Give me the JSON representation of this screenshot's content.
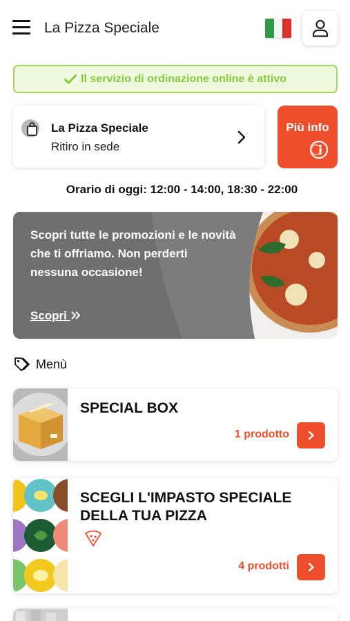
{
  "header": {
    "title": "La Pizza Speciale",
    "menu_icon": "hamburger-icon",
    "language_flag": "italy-flag-icon",
    "user_icon": "user-icon"
  },
  "status": {
    "text": "Il servizio di ordinazione online è attivo",
    "icon": "check-icon",
    "color": "#86c740"
  },
  "store": {
    "name": "La Pizza Speciale",
    "mode": "Ritiro in sede"
  },
  "info_button": {
    "label": "Più info",
    "color": "#ee4e2c"
  },
  "hours": {
    "text": "Orario di oggi: 12:00 - 14:00, 18:30 - 22:00"
  },
  "promo": {
    "text": "Scopri tutte le promozioni e le novità che ti offriamo. Non perderti nessuna occasione!",
    "link": "Scopri",
    "link_icon": "double-chevron-right-icon"
  },
  "menu": {
    "label": "Menù",
    "icon": "tag-icon",
    "categories": [
      {
        "title": "SPECIAL BOX",
        "count": "1 prodotto",
        "image": "box-icon"
      },
      {
        "title": "SCEGLI L'IMPASTO SPECIALE DELLA TUA PIZZA",
        "count": "4 prodotti",
        "image": "herbs-pattern",
        "badge_icon": "pizza-slice-icon"
      }
    ]
  }
}
